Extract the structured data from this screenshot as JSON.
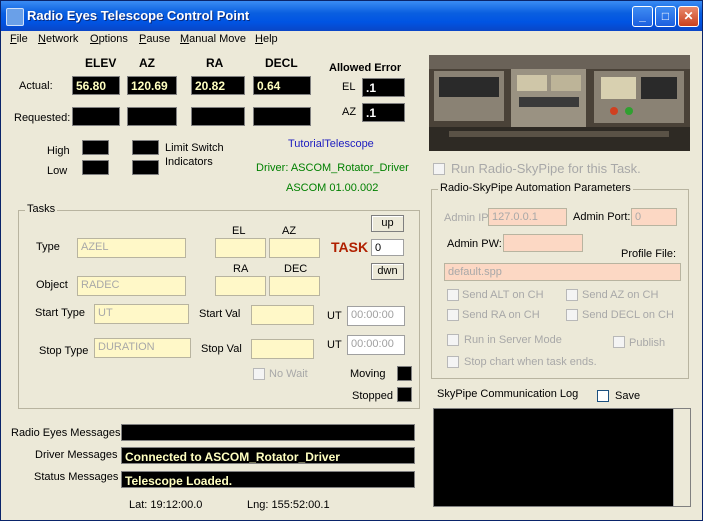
{
  "window": {
    "title": "Radio Eyes Telescope Control Point"
  },
  "menu": [
    "File",
    "Network",
    "Options",
    "Pause",
    "Manual Move",
    "Help"
  ],
  "position": {
    "headers": {
      "elev": "ELEV",
      "az": "AZ",
      "ra": "RA",
      "decl": "DECL"
    },
    "actual_label": "Actual:",
    "requested_label": "Requested:",
    "actual": {
      "elev": "56.80",
      "az": "120.69",
      "ra": "20.82",
      "decl": "0.64"
    }
  },
  "allowed_error": {
    "title": "Allowed Error",
    "el_label": "EL",
    "az_label": "AZ",
    "el": ".1",
    "az": ".1"
  },
  "limits": {
    "high": "High",
    "low": "Low",
    "indicators_line1": "Limit Switch",
    "indicators_line2": "Indicators"
  },
  "telescope": {
    "name": "TutorialTelescope",
    "driver": "Driver: ASCOM_Rotator_Driver",
    "ascom": "ASCOM 01.00.002"
  },
  "tasks": {
    "legend": "Tasks",
    "type_label": "Type",
    "type_value": "AZEL",
    "object_label": "Object",
    "object_value": "RADEC",
    "start_type_label": "Start Type",
    "start_type_value": "UT",
    "stop_type_label": "Stop Type",
    "stop_type_value": "DURATION",
    "el_label": "EL",
    "az_label": "AZ",
    "ra_label": "RA",
    "dec_label": "DEC",
    "start_val_label": "Start Val",
    "stop_val_label": "Stop Val",
    "ut_label": "UT",
    "ut_start": "00:00:00",
    "ut_stop": "00:00:00",
    "task_label": "TASK",
    "task_number": "0",
    "up": "up",
    "dwn": "dwn",
    "no_wait": "No Wait",
    "moving": "Moving",
    "stopped": "Stopped"
  },
  "skypipe": {
    "run_label": "Run Radio-SkyPipe for this Task.",
    "params_legend": "Radio-SkyPipe Automation Parameters",
    "admin_ip_label": "Admin IP:",
    "admin_ip": "127.0.0.1",
    "admin_port_label": "Admin Port:",
    "admin_port": "0",
    "admin_pw_label": "Admin PW:",
    "profile_label": "Profile File:",
    "profile": "default.spp",
    "options": [
      "Send ALT on CH",
      "Send AZ on CH",
      "Send RA on CH",
      "Send DECL on CH",
      "Run in Server Mode",
      "Publish",
      "Stop chart when task ends."
    ],
    "log_label": "SkyPipe Communication Log",
    "save_label": "Save"
  },
  "messages": {
    "radio_eyes_label": "Radio Eyes Messages",
    "radio_eyes": "",
    "driver_label": "Driver Messages",
    "driver": "Connected to ASCOM_Rotator_Driver",
    "status_label": "Status Messages",
    "status": "Telescope Loaded."
  },
  "footer": {
    "lat": "Lat: 19:12:00.0",
    "lng": "Lng: 155:52:00.1"
  }
}
